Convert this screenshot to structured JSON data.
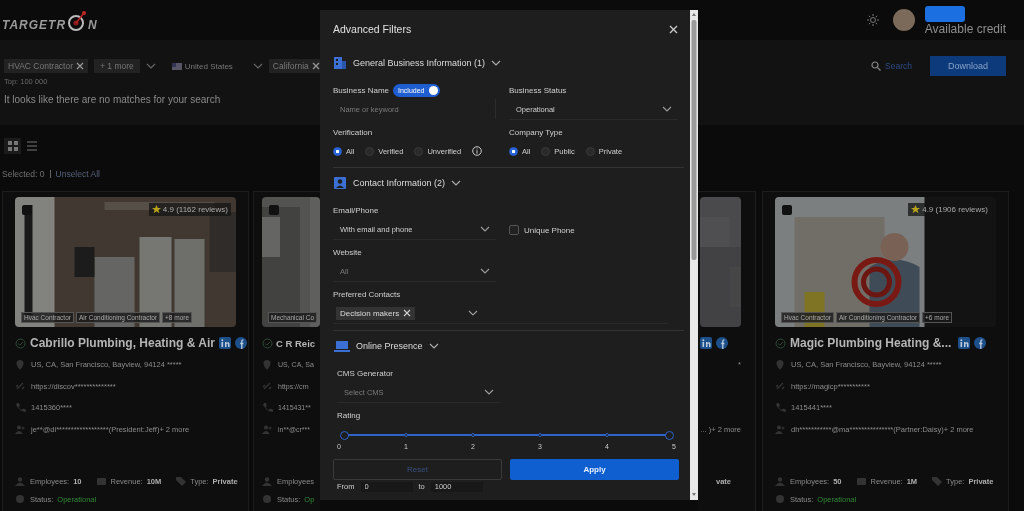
{
  "header": {
    "logo": {
      "before": "TARGETR",
      "after": "N"
    },
    "credit_label": "Available credit"
  },
  "filters": {
    "industry": {
      "chips": [
        "HVAC Contractor"
      ],
      "more": "+ 1 more"
    },
    "country": "United States",
    "state": {
      "chips": [
        "California"
      ]
    },
    "top": "Top: 100 000",
    "search": "Search",
    "download": "Download"
  },
  "message": "It looks like there are no matches for your search",
  "views": [
    {
      "kind": "grid",
      "selected": true
    },
    {
      "kind": "list",
      "selected": false
    }
  ],
  "selection": {
    "label": "Selected: 0",
    "action": "Unselect All"
  },
  "cards": [
    {
      "kind": "full",
      "checked": false,
      "rating": "4.9 (1162 reviews)",
      "tags": [
        "Hvac Contractor",
        "Air Conditioning Contractor",
        "+8 more"
      ],
      "name": "Cabrillo Plumbing, Heating & Air",
      "social": true,
      "address": "US, CA, San Francisco, Bayview, 94124 *****",
      "website": "https://discov**************",
      "phone": "1415360****",
      "email": "je**@di******************(President:Jeff)+ 2 more",
      "stats": [
        {
          "kind": "employees",
          "label": "Employees:",
          "value": "10"
        },
        {
          "kind": "revenue",
          "label": "Revenue:",
          "value": "10M"
        },
        {
          "kind": "type",
          "label": "Type:",
          "value": "Private"
        }
      ],
      "status": {
        "label": "Status:",
        "value": "Operational"
      }
    },
    {
      "kind": "left-part",
      "checked": false,
      "tags": [
        "Mechanical Co"
      ],
      "name": "C R Reic",
      "address": "US, CA, Sa",
      "website": "https://crn",
      "phone": "1415431**",
      "email": "in**@cr***",
      "stats": [
        {
          "kind": "employees",
          "label": "Employees"
        }
      ],
      "status": {
        "label": "Status:",
        "value": "Op"
      }
    },
    {
      "kind": "right-part",
      "social": true,
      "address": "*",
      "email": "... )+ 2 more",
      "stats": [
        {
          "value": "vate"
        }
      ]
    },
    {
      "kind": "full",
      "checked": false,
      "rating": "4.9 (1906 reviews)",
      "tags": [
        "Hvac Contractor",
        "Air Conditioning Contractor",
        "+6 more"
      ],
      "name": "Magic Plumbing Heating &...",
      "social": true,
      "address": "US, CA, San Francisco, Bayview, 94124 *****",
      "website": "https://magicp***********",
      "phone": "1415441****",
      "email": "dh***********@ma***************(Partner:Daisy)+ 2 more",
      "stats": [
        {
          "kind": "employees",
          "label": "Employees:",
          "value": "50"
        },
        {
          "kind": "revenue",
          "label": "Revenue:",
          "value": "1M"
        },
        {
          "kind": "type",
          "label": "Type:",
          "value": "Private"
        }
      ],
      "status": {
        "label": "Status:",
        "value": "Operational"
      }
    }
  ],
  "modal": {
    "title": "Advanced Filters",
    "sections": [
      {
        "title": "General Business Information (1)",
        "expanded": true,
        "rows": [
          [
            {
              "kind": "text",
              "label": "Business Name",
              "toggle": {
                "label": "Included",
                "on": true
              },
              "placeholder": "Name or keyword"
            },
            {
              "kind": "select",
              "label": "Business Status",
              "value": "Operational"
            }
          ],
          [
            {
              "kind": "radios",
              "label": "Verification",
              "info": true,
              "options": [
                {
                  "label": "All",
                  "selected": true
                },
                {
                  "label": "Verified",
                  "selected": false
                },
                {
                  "label": "Unverified",
                  "selected": false
                }
              ]
            },
            {
              "kind": "radios",
              "label": "Company Type",
              "options": [
                {
                  "label": "All",
                  "selected": true
                },
                {
                  "label": "Public",
                  "selected": false
                },
                {
                  "label": "Private",
                  "selected": false
                }
              ]
            }
          ]
        ]
      },
      {
        "title": "Contact Information (2)",
        "expanded": true,
        "rows": [
          [
            {
              "kind": "select",
              "label": "Email/Phone",
              "value": "With email and phone"
            },
            {
              "kind": "checkbox",
              "label": "Unique Phone",
              "checked": false
            }
          ],
          [
            {
              "kind": "select",
              "label": "Website",
              "placeholder": "All"
            }
          ],
          [
            {
              "kind": "multiselect",
              "label": "Preferred Contacts",
              "chips": [
                "Decision makers"
              ]
            }
          ]
        ]
      },
      {
        "title": "Online Presence",
        "expanded": true,
        "rows": [
          [
            {
              "kind": "select",
              "label": "CMS Generator",
              "placeholder": "Select CMS"
            }
          ],
          [
            {
              "kind": "range",
              "label": "Rating",
              "ticks": [
                "0",
                "1",
                "2",
                "3",
                "4",
                "5"
              ]
            }
          ]
        ]
      }
    ],
    "reset": "Reset",
    "apply": "Apply",
    "peek": {
      "from": "From",
      "from_value": "0",
      "to": "to",
      "to_value": "1000"
    }
  }
}
